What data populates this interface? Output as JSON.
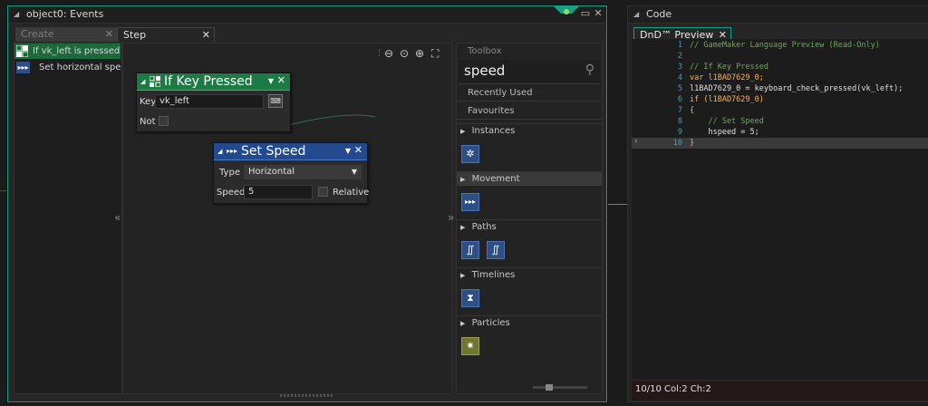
{
  "events_window": {
    "title": "object0: Events",
    "tabs": [
      {
        "label": "Create"
      },
      {
        "label": "Step"
      }
    ],
    "event_list": [
      {
        "label": "If vk_left is pressed"
      },
      {
        "label": "Set horizontal speed"
      }
    ],
    "collapse_left": "«",
    "collapse_right": "»"
  },
  "blocks": {
    "if_key_pressed": {
      "title": "If Key Pressed",
      "key_label": "Key",
      "key_value": "vk_left",
      "not_label": "Not",
      "color": "#1c7a45"
    },
    "set_speed": {
      "title": "Set Speed",
      "type_label": "Type",
      "type_value": "Horizontal",
      "speed_label": "Speed",
      "speed_value": "5",
      "relative_label": "Relative",
      "color": "#234a8e"
    }
  },
  "toolbox": {
    "header": "Toolbox",
    "search_value": "speed",
    "recently_used": "Recently Used",
    "favourites": "Favourites",
    "categories": [
      {
        "label": "Instances"
      },
      {
        "label": "Movement"
      },
      {
        "label": "Paths"
      },
      {
        "label": "Timelines"
      },
      {
        "label": "Particles"
      }
    ]
  },
  "code_window": {
    "title": "Code",
    "tab_label": "DnD™ Preview",
    "lines": [
      {
        "n": "1",
        "text": "// GameMaker Language Preview (Read-Only)"
      },
      {
        "n": "2",
        "text": ""
      },
      {
        "n": "3",
        "text": "// If Key Pressed"
      },
      {
        "n": "4",
        "text": "var l1BAD7629_0;"
      },
      {
        "n": "5",
        "text": "l1BAD7629_0 = keyboard_check_pressed(vk_left);"
      },
      {
        "n": "6",
        "text": "if (l1BAD7629_0)"
      },
      {
        "n": "7",
        "text": "{"
      },
      {
        "n": "8",
        "text": "    // Set Speed"
      },
      {
        "n": "9",
        "text": "    hspeed = 5;"
      },
      {
        "n": "10",
        "text": "}"
      }
    ],
    "status": "10/10 Col:2 Ch:2"
  }
}
